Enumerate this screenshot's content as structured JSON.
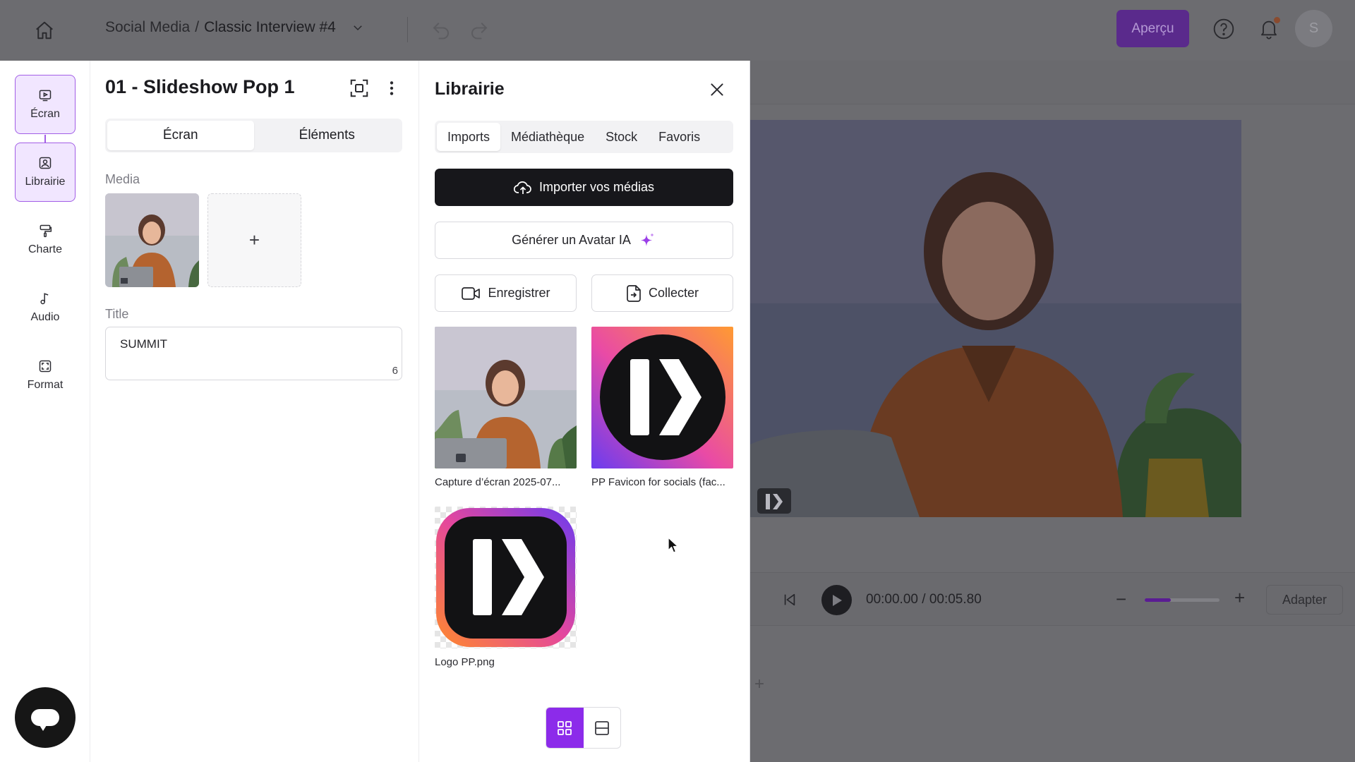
{
  "topbar": {
    "breadcrumb_section": "Social Media",
    "breadcrumb_sep": "/",
    "project_title": "Classic Interview #4",
    "preview_label": "Aperçu",
    "avatar_initial": "S"
  },
  "leftnav": {
    "items": [
      {
        "label": "Écran",
        "icon": "screen-icon",
        "active": true
      },
      {
        "label": "Librairie",
        "icon": "library-icon",
        "active": true
      },
      {
        "label": "Charte",
        "icon": "paint-roller-icon",
        "active": false
      },
      {
        "label": "Audio",
        "icon": "music-note-icon",
        "active": false
      },
      {
        "label": "Format",
        "icon": "format-icon",
        "active": false
      }
    ]
  },
  "screen_panel": {
    "title": "01 - Slideshow Pop 1",
    "tabs": [
      {
        "label": "Écran",
        "active": true
      },
      {
        "label": "Éléments",
        "active": false
      }
    ],
    "media_label": "Media",
    "add_symbol": "+",
    "title_label": "Title",
    "title_value": "SUMMIT",
    "title_char_count": "6"
  },
  "library": {
    "title": "Librairie",
    "tabs": [
      {
        "label": "Imports",
        "active": true
      },
      {
        "label": "Médiathèque",
        "active": false
      },
      {
        "label": "Stock",
        "active": false
      },
      {
        "label": "Favoris",
        "active": false
      }
    ],
    "import_label": "Importer vos médias",
    "avatar_label": "Générer un Avatar IA",
    "record_label": "Enregistrer",
    "collect_label": "Collecter",
    "assets": [
      {
        "caption": "Capture d’écran 2025-07...",
        "kind": "photo"
      },
      {
        "caption": "PP Favicon for socials (fac...",
        "kind": "gradient-logo"
      },
      {
        "caption": "Logo PP.png",
        "kind": "dark-logo"
      }
    ],
    "view_mode": "grid"
  },
  "player": {
    "time_current": "00:00.00",
    "time_sep": " / ",
    "time_total": "00:05.80",
    "zoom_level": 0.35,
    "minus_symbol": "−",
    "plus_symbol": "+",
    "fit_label": "Adapter",
    "add_track_symbol": "+"
  },
  "colors": {
    "accent_purple": "#8c2bea",
    "nav_active_bg": "#f1e6ff",
    "primary_dark": "#17171b",
    "overlay_gray": "#6c6c70"
  }
}
